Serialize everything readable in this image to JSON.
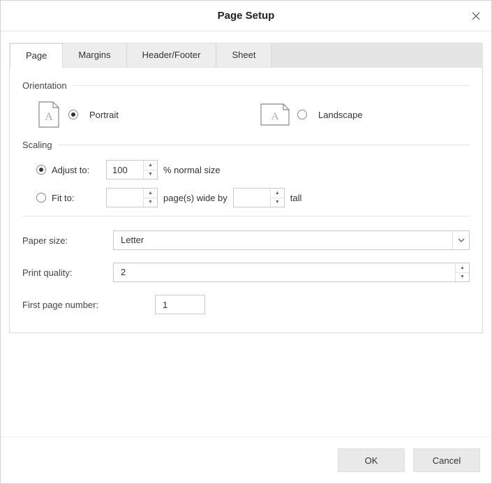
{
  "dialog": {
    "title": "Page Setup"
  },
  "tabs": {
    "page": "Page",
    "margins": "Margins",
    "headerFooter": "Header/Footer",
    "sheet": "Sheet"
  },
  "orientation": {
    "group_label": "Orientation",
    "portrait": "Portrait",
    "landscape": "Landscape",
    "selected": "portrait"
  },
  "scaling": {
    "group_label": "Scaling",
    "adjust_label": "Adjust to:",
    "adjust_value": "100",
    "adjust_suffix": "% normal size",
    "fit_label": "Fit to:",
    "fit_wide": "",
    "fit_middle": "page(s) wide by",
    "fit_tall": "",
    "fit_suffix": "tall",
    "selected": "adjust"
  },
  "paper": {
    "label": "Paper size:",
    "value": "Letter"
  },
  "quality": {
    "label": "Print quality:",
    "value": "2"
  },
  "firstPage": {
    "label": "First page number:",
    "value": "1"
  },
  "buttons": {
    "ok": "OK",
    "cancel": "Cancel"
  }
}
